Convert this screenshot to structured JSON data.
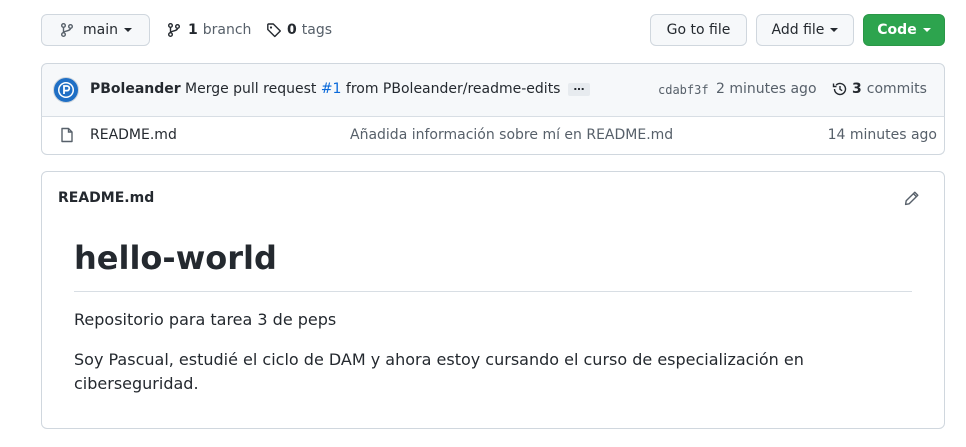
{
  "colors": {
    "accent": "#0969da",
    "primary_button": "#2da44e",
    "border": "#d0d7de",
    "muted": "#57606a"
  },
  "toolbar": {
    "branch_selector": "main",
    "branch_count": "1",
    "branch_label": "branch",
    "tag_count": "0",
    "tag_label": "tags",
    "go_to_file": "Go to file",
    "add_file": "Add file",
    "code": "Code"
  },
  "commit": {
    "author": "PBoleander",
    "message_prefix": "Merge pull request",
    "pr_link": "#1",
    "message_suffix": "from PBoleander/readme-edits",
    "ellipsis": "…",
    "sha": "cdabf3f",
    "time": "2 minutes ago",
    "commit_count": "3",
    "commit_label": "commits"
  },
  "files": [
    {
      "name": "README.md",
      "message": "Añadida información sobre mí en README.md",
      "time": "14 minutes ago",
      "icon": "file-icon"
    }
  ],
  "readme": {
    "header": "README.md",
    "title": "hello-world",
    "paragraph1": "Repositorio para tarea 3 de peps",
    "paragraph2_line1": "Soy Pascual, estudié el ciclo de DAM y ahora estoy cursando el curso de especialización en",
    "paragraph2_line2": "ciberseguridad."
  }
}
